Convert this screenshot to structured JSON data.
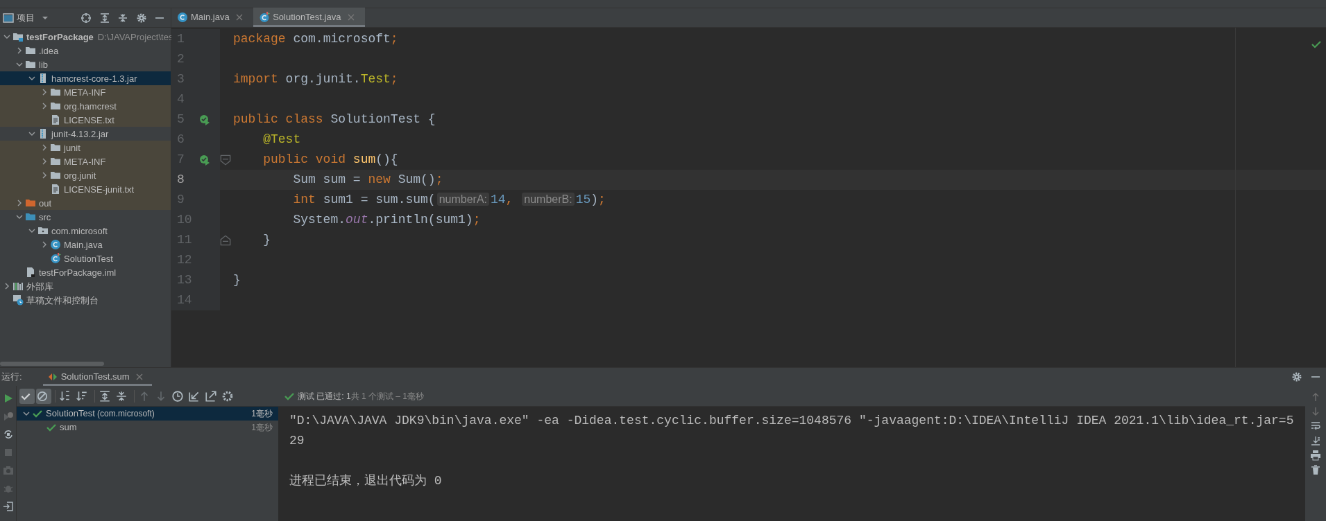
{
  "project_panel": {
    "title": "项目",
    "tree": [
      {
        "label": "testForPackage",
        "path": "D:\\JAVAProject\\tes",
        "kind": "project",
        "expanded": true,
        "selected": false,
        "tinted": false,
        "children": [
          {
            "label": ".idea",
            "kind": "folder",
            "expanded": false,
            "selected": false,
            "tinted": false
          },
          {
            "label": "lib",
            "kind": "folder",
            "expanded": true,
            "selected": false,
            "tinted": false,
            "children": [
              {
                "label": "hamcrest-core-1.3.jar",
                "kind": "jar",
                "expanded": true,
                "selected": true,
                "tinted": false,
                "children": [
                  {
                    "label": "META-INF",
                    "kind": "folder",
                    "expanded": false,
                    "selected": false,
                    "tinted": true
                  },
                  {
                    "label": "org.hamcrest",
                    "kind": "folder",
                    "expanded": false,
                    "selected": false,
                    "tinted": true
                  },
                  {
                    "label": "LICENSE.txt",
                    "kind": "text",
                    "selected": false,
                    "tinted": true
                  }
                ]
              },
              {
                "label": "junit-4.13.2.jar",
                "kind": "jar",
                "expanded": true,
                "selected": false,
                "tinted": false,
                "children": [
                  {
                    "label": "junit",
                    "kind": "folder",
                    "expanded": false,
                    "selected": false,
                    "tinted": true
                  },
                  {
                    "label": "META-INF",
                    "kind": "folder",
                    "expanded": false,
                    "selected": false,
                    "tinted": true
                  },
                  {
                    "label": "org.junit",
                    "kind": "folder",
                    "expanded": false,
                    "selected": false,
                    "tinted": true
                  },
                  {
                    "label": "LICENSE-junit.txt",
                    "kind": "text",
                    "selected": false,
                    "tinted": true
                  }
                ]
              }
            ]
          },
          {
            "label": "out",
            "kind": "excluded",
            "expanded": false,
            "selected": false,
            "tinted": true
          },
          {
            "label": "src",
            "kind": "source",
            "expanded": true,
            "selected": false,
            "tinted": false,
            "children": [
              {
                "label": "com.microsoft",
                "kind": "package",
                "expanded": true,
                "selected": false,
                "tinted": false,
                "children": [
                  {
                    "label": "Main.java",
                    "kind": "class",
                    "expanded": false,
                    "selected": false,
                    "tinted": false
                  },
                  {
                    "label": "SolutionTest",
                    "kind": "test",
                    "selected": false,
                    "tinted": false
                  }
                ]
              }
            ]
          },
          {
            "label": "testForPackage.iml",
            "kind": "module",
            "selected": false,
            "tinted": false
          }
        ]
      },
      {
        "label": "外部库",
        "kind": "library",
        "expanded": false,
        "selected": false,
        "tinted": false
      },
      {
        "label": "草稿文件和控制台",
        "kind": "scratch",
        "selected": false,
        "tinted": false
      }
    ]
  },
  "editor": {
    "tabs": [
      {
        "label": "Main.java",
        "kind": "class",
        "selected": false
      },
      {
        "label": "SolutionTest.java",
        "kind": "test",
        "selected": true
      }
    ],
    "lines": [
      {
        "number": "1",
        "run_marker": false,
        "current": false,
        "tokens": [
          {
            "kind": "kw",
            "text": "package"
          },
          {
            "kind": "plain",
            "text": " com.microsoft"
          },
          {
            "kind": "kw",
            "text": ";"
          }
        ]
      },
      {
        "number": "2",
        "run_marker": false,
        "current": false
      },
      {
        "number": "3",
        "run_marker": false,
        "current": false,
        "tokens": [
          {
            "kind": "kw",
            "text": "import"
          },
          {
            "kind": "plain",
            "text": " org.junit."
          },
          {
            "kind": "ann",
            "text": "Test"
          },
          {
            "kind": "kw",
            "text": ";"
          }
        ]
      },
      {
        "number": "4",
        "run_marker": false,
        "current": false
      },
      {
        "number": "5",
        "run_marker": true,
        "current": false,
        "tokens": [
          {
            "kind": "kw",
            "text": "public class "
          },
          {
            "kind": "plain",
            "text": "SolutionTest {"
          }
        ]
      },
      {
        "number": "6",
        "run_marker": false,
        "current": false,
        "tokens": [
          {
            "kind": "ann",
            "text": "    @Test"
          }
        ]
      },
      {
        "number": "7",
        "run_marker": true,
        "current": false,
        "kind": "fold-start",
        "tokens": [
          {
            "kind": "kw",
            "text": "    public void "
          },
          {
            "kind": "method",
            "text": "sum"
          },
          {
            "kind": "plain",
            "text": "(){"
          }
        ]
      },
      {
        "number": "8",
        "run_marker": false,
        "current": true,
        "tokens": [
          {
            "kind": "plain",
            "text": "        Sum sum = "
          },
          {
            "kind": "kw",
            "text": "new "
          },
          {
            "kind": "plain",
            "text": "Sum()"
          },
          {
            "kind": "kw",
            "text": ";"
          }
        ]
      },
      {
        "number": "9",
        "run_marker": false,
        "current": false,
        "tokens": [
          {
            "kind": "kw",
            "text": "        int "
          },
          {
            "kind": "plain",
            "text": "sum1 = sum.sum("
          },
          {
            "kind": "hint",
            "text": "numberA:"
          },
          {
            "kind": "num",
            "text": "14"
          },
          {
            "kind": "kw",
            "text": ", "
          },
          {
            "kind": "hint",
            "text": "numberB:"
          },
          {
            "kind": "num",
            "text": "15"
          },
          {
            "kind": "plain",
            "text": ")"
          },
          {
            "kind": "kw",
            "text": ";"
          }
        ]
      },
      {
        "number": "10",
        "run_marker": false,
        "current": false,
        "tokens": [
          {
            "kind": "plain",
            "text": "        System."
          },
          {
            "kind": "static",
            "text": "out"
          },
          {
            "kind": "plain",
            "text": ".println(sum1)"
          },
          {
            "kind": "kw",
            "text": ";"
          }
        ]
      },
      {
        "number": "11",
        "run_marker": false,
        "current": false,
        "kind": "fold-end",
        "tokens": [
          {
            "kind": "plain",
            "text": "    }"
          }
        ]
      },
      {
        "number": "12",
        "run_marker": false,
        "current": false
      },
      {
        "number": "13",
        "run_marker": false,
        "current": false,
        "tokens": [
          {
            "kind": "plain",
            "text": "}"
          }
        ]
      },
      {
        "number": "14",
        "run_marker": false,
        "current": false
      }
    ]
  },
  "run_panel": {
    "label": "运行:",
    "tab": "SolutionTest.sum",
    "toolbar": [
      {
        "kind": "show-passed",
        "on": true,
        "disabled": false
      },
      {
        "kind": "show-ignored",
        "on": true,
        "disabled": false
      },
      {
        "kind": "sort-alpha",
        "on": false,
        "disabled": false
      },
      {
        "kind": "sort-duration",
        "on": false,
        "disabled": false
      },
      {
        "kind": "expand",
        "on": false,
        "disabled": false
      },
      {
        "kind": "collapse",
        "on": false,
        "disabled": false
      },
      {
        "kind": "up",
        "on": false,
        "disabled": true
      },
      {
        "kind": "down",
        "on": false,
        "disabled": true
      },
      {
        "kind": "history",
        "on": false,
        "disabled": false
      },
      {
        "kind": "import",
        "on": false,
        "disabled": false
      },
      {
        "kind": "export",
        "on": false,
        "disabled": false
      },
      {
        "kind": "settings",
        "on": false,
        "disabled": false
      }
    ],
    "status": {
      "passed": true,
      "label": "测试",
      "count": "已通过: 1",
      "summary": "共 1 个测试 – 1毫秒"
    },
    "tests": [
      {
        "label": "SolutionTest",
        "package": "(com.microsoft)",
        "time": "1毫秒",
        "passed": true,
        "selected": true,
        "expanded": true,
        "children": [
          {
            "label": "sum",
            "time": "1毫秒",
            "passed": true,
            "selected": false
          }
        ]
      }
    ],
    "console": [
      {
        "kind": "command",
        "text": "\"D:\\JAVA\\JAVA JDK9\\bin\\java.exe\" -ea -Didea.test.cyclic.buffer.size=1048576 \"-javaagent:D:\\IDEA\\IntelliJ IDEA 2021.1\\lib\\idea_rt.jar=5"
      },
      {
        "kind": "output",
        "text": "29"
      },
      {
        "kind": "exit",
        "text": "进程已结束，退出代码为 0"
      }
    ]
  }
}
